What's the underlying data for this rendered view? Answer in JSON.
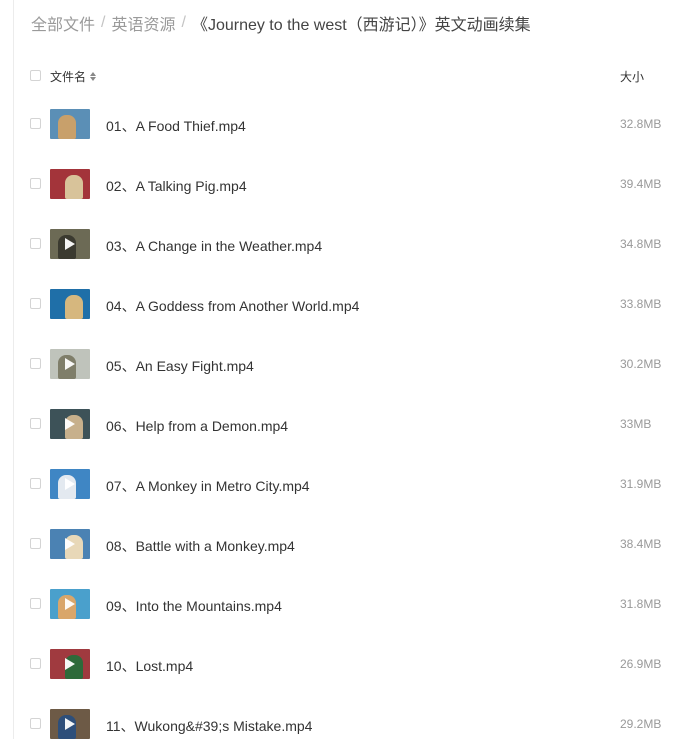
{
  "breadcrumb": {
    "items": [
      "全部文件",
      "英语资源"
    ],
    "separator": "/",
    "current": "《Journey to the west（西游记）》英文动画续集"
  },
  "header": {
    "name_label": "文件名",
    "size_label": "大小"
  },
  "files": [
    {
      "name": "01、A Food Thief.mp4",
      "size": "32.8MB"
    },
    {
      "name": "02、A Talking Pig.mp4",
      "size": "39.4MB"
    },
    {
      "name": "03、A Change in the Weather.mp4",
      "size": "34.8MB"
    },
    {
      "name": "04、A Goddess from Another World.mp4",
      "size": "33.8MB"
    },
    {
      "name": "05、An Easy Fight.mp4",
      "size": "30.2MB"
    },
    {
      "name": "06、Help from a Demon.mp4",
      "size": "33MB"
    },
    {
      "name": "07、A Monkey in Metro City.mp4",
      "size": "31.9MB"
    },
    {
      "name": "08、Battle with a Monkey.mp4",
      "size": "38.4MB"
    },
    {
      "name": "09、Into the Mountains.mp4",
      "size": "31.8MB"
    },
    {
      "name": "10、Lost.mp4",
      "size": "26.9MB"
    },
    {
      "name": "11、Wukong&#39;s Mistake.mp4",
      "size": "29.2MB"
    }
  ],
  "thumbnail_colors": [
    [
      "#5b8fb6",
      "#c8a06b"
    ],
    [
      "#a3343a",
      "#d8c39a"
    ],
    [
      "#6c6a55",
      "#3b3a30"
    ],
    [
      "#1f6fa8",
      "#d6b77e"
    ],
    [
      "#bfc3bb",
      "#7f7e6a"
    ],
    [
      "#3d5258",
      "#c7b08c"
    ],
    [
      "#3f86c4",
      "#e3e9f0"
    ],
    [
      "#4b82b3",
      "#e8d8b8"
    ],
    [
      "#4aa0cc",
      "#d9a66a"
    ],
    [
      "#a03a3f",
      "#2e6a3a"
    ],
    [
      "#6d5a46",
      "#2e4f7a"
    ]
  ],
  "play_overlay": [
    false,
    false,
    true,
    false,
    true,
    true,
    true,
    true,
    true,
    true,
    true
  ]
}
